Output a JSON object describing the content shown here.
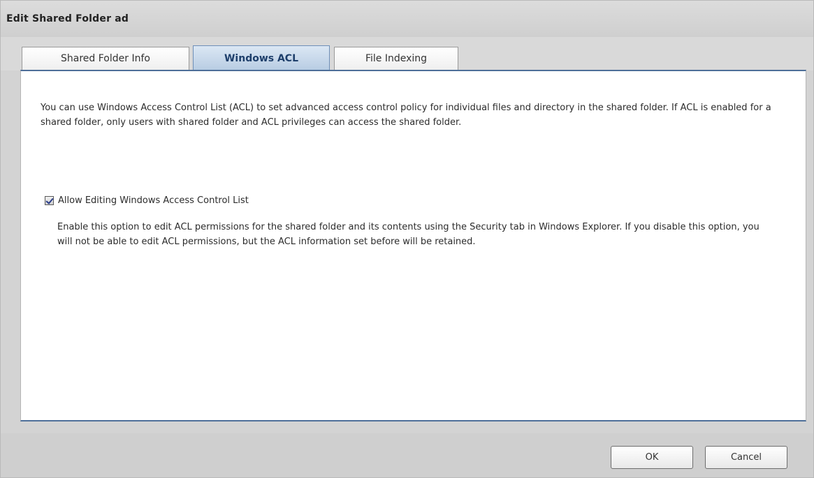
{
  "window": {
    "title": "Edit Shared Folder ad"
  },
  "tabs": [
    {
      "label": "Shared Folder Info",
      "active": false
    },
    {
      "label": "Windows ACL",
      "active": true
    },
    {
      "label": "File Indexing",
      "active": false
    }
  ],
  "content": {
    "description": "You can use Windows Access Control List (ACL) to set advanced access control policy for individual files and directory in the shared folder. If ACL is enabled for a shared folder, only users with shared folder and ACL privileges can access the shared folder.",
    "checkbox": {
      "label": "Allow Editing Windows Access Control List",
      "checked": true
    },
    "checkbox_description": "Enable this option to edit ACL permissions for the shared folder and its contents using the Security tab in Windows Explorer. If you disable this option, you will not be able to edit ACL permissions, but the ACL information set before will be retained."
  },
  "footer": {
    "ok_label": "OK",
    "cancel_label": "Cancel"
  },
  "colors": {
    "active_tab": "#b6cbe2",
    "panel_border": "#4e6f99",
    "chrome": "#d3d3d3"
  }
}
